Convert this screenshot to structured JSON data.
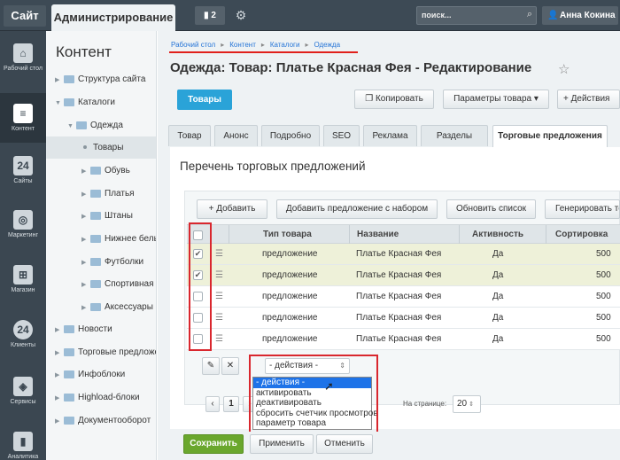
{
  "topbar": {
    "site_label": "Сайт",
    "admin_label": "Администрирование",
    "notifications_count": "2",
    "search_placeholder": "поиск...",
    "user_name": "Анна Кокина"
  },
  "leftnav": {
    "items": [
      {
        "label": "Рабочий стол",
        "icon": "home-icon"
      },
      {
        "label": "Контент",
        "icon": "document-icon"
      },
      {
        "label": "Сайты",
        "icon": "calendar-icon"
      },
      {
        "label": "Маркетинг",
        "icon": "target-icon"
      },
      {
        "label": "Магазин",
        "icon": "basket-icon"
      },
      {
        "label": "Клиенты",
        "icon": "clients-24-icon"
      },
      {
        "label": "Сервисы",
        "icon": "layers-icon"
      },
      {
        "label": "Аналитика",
        "icon": "chart-icon"
      }
    ]
  },
  "tree": {
    "title": "Контент",
    "items": [
      {
        "label": "Структура сайта"
      },
      {
        "label": "Каталоги"
      },
      {
        "label": "Одежда"
      },
      {
        "label": "Товары"
      },
      {
        "label": "Обувь"
      },
      {
        "label": "Платья"
      },
      {
        "label": "Штаны"
      },
      {
        "label": "Нижнее белье"
      },
      {
        "label": "Футболки"
      },
      {
        "label": "Спортивная"
      },
      {
        "label": "Аксессуары"
      },
      {
        "label": "Новости"
      },
      {
        "label": "Торговые предложения"
      },
      {
        "label": "Инфоблоки"
      },
      {
        "label": "Highload-блоки"
      },
      {
        "label": "Документооборот"
      }
    ]
  },
  "breadcrumb": [
    "Рабочий стол",
    "Контент",
    "Каталоги",
    "Одежда"
  ],
  "page_title": "Одежда: Товар: Платье Красная Фея - Редактирование",
  "toolbar": {
    "back_label": "Товары",
    "copy_label": "Копировать",
    "params_label": "Параметры товара",
    "actions_label": "Действия"
  },
  "tabs": [
    "Товар",
    "Анонс",
    "Подробно",
    "SEO",
    "Реклама",
    "Разделы",
    "Торговые предложения"
  ],
  "offers": {
    "title": "Перечень торговых предложений",
    "add_label": "Добавить",
    "add_set_label": "Добавить предложение с набором",
    "refresh_label": "Обновить список",
    "generate_label": "Генерировать товары",
    "columns": [
      "Тип товара",
      "Название",
      "Активность",
      "Сортировка"
    ],
    "rows": [
      {
        "type": "предложение",
        "name": "Платье Красная Фея",
        "active": "Да",
        "sort": "500",
        "checked": true
      },
      {
        "type": "предложение",
        "name": "Платье Красная Фея",
        "active": "Да",
        "sort": "500",
        "checked": true
      },
      {
        "type": "предложение",
        "name": "Платье Красная Фея",
        "active": "Да",
        "sort": "500",
        "checked": false
      },
      {
        "type": "предложение",
        "name": "Платье Красная Фея",
        "active": "Да",
        "sort": "500",
        "checked": false
      },
      {
        "type": "предложение",
        "name": "Платье Красная Фея",
        "active": "Да",
        "sort": "500",
        "checked": false
      }
    ],
    "actions_select": "- действия -",
    "actions_options": [
      "- действия -",
      "активировать",
      "деактивировать",
      "сбросить счетчик просмотров",
      "параметр товара"
    ],
    "page_number": "1",
    "per_page_label": "На странице:",
    "per_page_value": "20"
  },
  "footer": {
    "save_label": "Сохранить",
    "apply_label": "Применить",
    "cancel_label": "Отменить"
  },
  "colors": {
    "accent_blue": "#2aa3d8",
    "save_green": "#6aa72d",
    "highlight_red": "#d9272e",
    "selected_row": "#eef1d9"
  }
}
